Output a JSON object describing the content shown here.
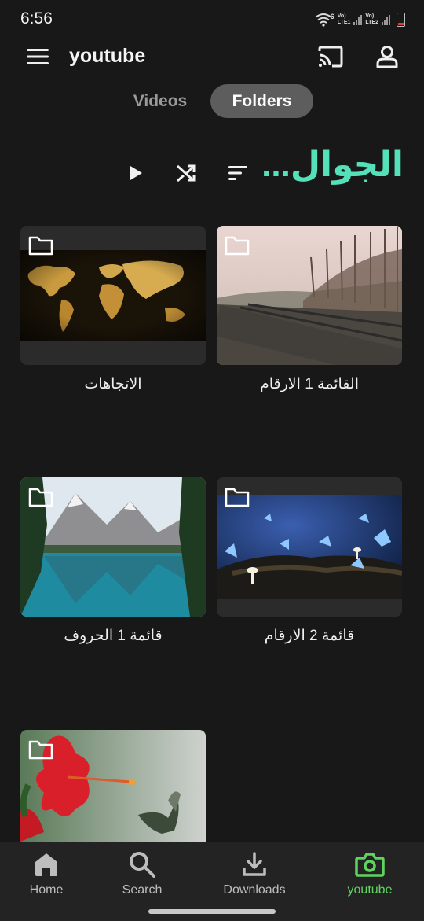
{
  "status_bar": {
    "time": "6:56",
    "sim1_label": "LTE1",
    "sim2_label": "LTE2",
    "volte": "Vo)",
    "wifi_gen": "6"
  },
  "app_bar": {
    "title": "youtube",
    "icons": [
      "menu-icon",
      "cast-icon",
      "account-icon"
    ]
  },
  "tabs": [
    {
      "label": "Videos",
      "selected": false
    },
    {
      "label": "Folders",
      "selected": true
    }
  ],
  "actions": {
    "folder_title": "الجوال...",
    "icons": [
      "play-icon",
      "shuffle-icon",
      "sort-icon"
    ]
  },
  "folders": [
    {
      "label": "الاتجاهات",
      "thumb": "world-map"
    },
    {
      "label": "القائمة 1 الارقام",
      "thumb": "railway"
    },
    {
      "label": "قائمة 1 الحروف",
      "thumb": "mountain-lake"
    },
    {
      "label": "قائمة 2 الارقام",
      "thumb": "blue-butterflies"
    },
    {
      "label": "",
      "thumb": "hibiscus-hummingbird"
    }
  ],
  "bottom_nav": [
    {
      "label": "Home",
      "icon": "home-icon",
      "active": false
    },
    {
      "label": "Search",
      "icon": "search-icon",
      "active": false
    },
    {
      "label": "Downloads",
      "icon": "download-icon",
      "active": false
    },
    {
      "label": "youtube",
      "icon": "camera-icon",
      "active": true
    }
  ],
  "colors": {
    "background": "#181818",
    "accent_title": "#54e0b8",
    "active_nav": "#5fd35f",
    "tab_selected_bg": "#5d5d5d"
  }
}
